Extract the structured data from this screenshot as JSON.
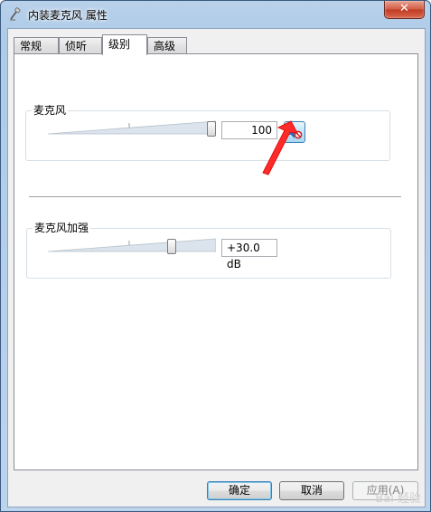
{
  "window": {
    "title": "内装麦克风 属性",
    "close_label": "✕"
  },
  "tabs": [
    {
      "label": "常规"
    },
    {
      "label": "侦听"
    },
    {
      "label": "级别"
    },
    {
      "label": "高级"
    }
  ],
  "active_tab": "级别",
  "microphone": {
    "label": "麦克风",
    "value": "100",
    "level_percent": 100
  },
  "boost": {
    "label": "麦克风加强",
    "value": "+30.0 dB",
    "level_percent": 75
  },
  "buttons": {
    "ok": "确定",
    "cancel": "取消",
    "apply": "应用(A)"
  },
  "colors": {
    "accent": "#3c7fb1",
    "arrow": "#ff2b2b"
  },
  "watermark": "Bai 经验"
}
